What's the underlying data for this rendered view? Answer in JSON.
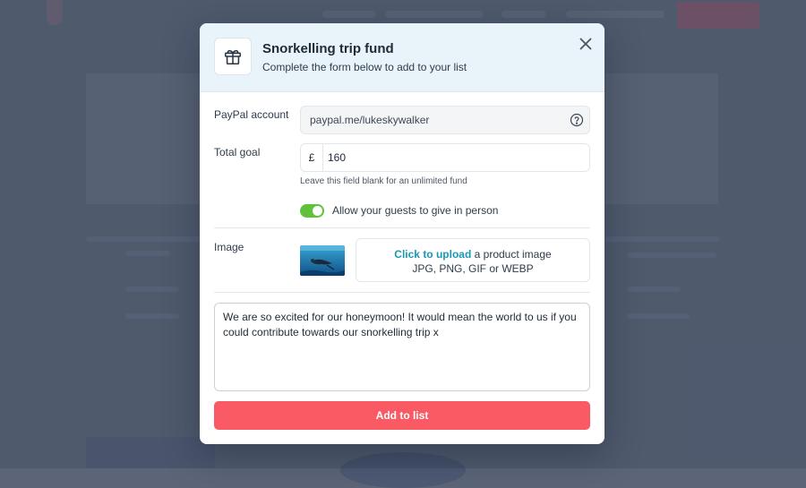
{
  "modal": {
    "title": "Snorkelling trip fund",
    "subtitle": "Complete the form below to add to your list",
    "icon": "gift-icon"
  },
  "form": {
    "paypal": {
      "label": "PayPal account",
      "value": "paypal.me/lukeskywalker",
      "help_icon": "question-circle-icon"
    },
    "goal": {
      "label": "Total goal",
      "currency": "£",
      "value": "160",
      "hint": "Leave this field blank for an unlimited fund"
    },
    "in_person": {
      "label": "Allow your guests to give in person",
      "enabled": true
    },
    "image": {
      "label": "Image",
      "upload_link": "Click to upload",
      "upload_text": " a product image",
      "formats": "JPG, PNG, GIF or WEBP"
    },
    "message": "We are so excited for our honeymoon! It would mean the world to us if you could contribute towards our snorkelling trip x",
    "submit_label": "Add to list"
  },
  "colors": {
    "header_bg": "#e9f4fa",
    "toggle_on": "#5fc23a",
    "link": "#1a97b4",
    "submit_bg": "#f95a63"
  }
}
